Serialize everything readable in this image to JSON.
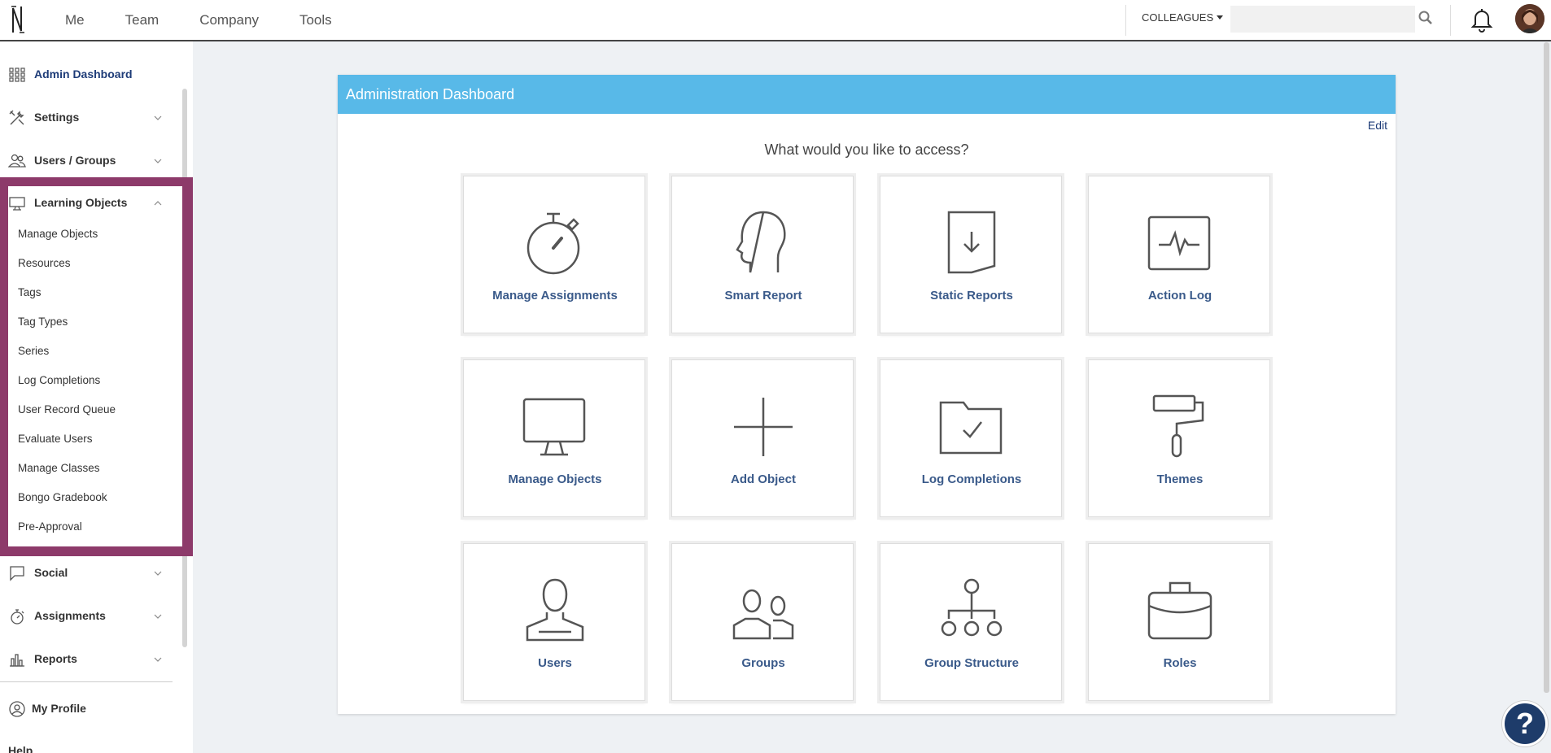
{
  "topbar": {
    "nav": [
      "Me",
      "Team",
      "Company",
      "Tools"
    ],
    "colleagues_label": "COLLEAGUES",
    "search_placeholder": ""
  },
  "sidebar": {
    "admin_dashboard": "Admin Dashboard",
    "settings": "Settings",
    "users_groups": "Users / Groups",
    "learning_objects": "Learning Objects",
    "sub_items": [
      "Manage Objects",
      "Resources",
      "Tags",
      "Tag Types",
      "Series",
      "Log Completions",
      "User Record Queue",
      "Evaluate Users",
      "Manage Classes",
      "Bongo Gradebook",
      "Pre-Approval"
    ],
    "social": "Social",
    "assignments": "Assignments",
    "reports": "Reports",
    "my_profile": "My Profile",
    "help": "Help"
  },
  "panel": {
    "title": "Administration Dashboard",
    "edit": "Edit",
    "question": "What would you like to access?",
    "tiles": [
      {
        "label": "Manage Assignments",
        "icon": "stopwatch-icon"
      },
      {
        "label": "Smart Report",
        "icon": "head-icon"
      },
      {
        "label": "Static Reports",
        "icon": "document-download-icon"
      },
      {
        "label": "Action Log",
        "icon": "activity-monitor-icon"
      },
      {
        "label": "Manage Objects",
        "icon": "monitor-icon"
      },
      {
        "label": "Add Object",
        "icon": "plus-icon"
      },
      {
        "label": "Log Completions",
        "icon": "folder-check-icon"
      },
      {
        "label": "Themes",
        "icon": "paint-roller-icon"
      },
      {
        "label": "Users",
        "icon": "user-icon"
      },
      {
        "label": "Groups",
        "icon": "group-icon"
      },
      {
        "label": "Group Structure",
        "icon": "hierarchy-icon"
      },
      {
        "label": "Roles",
        "icon": "briefcase-icon"
      }
    ]
  },
  "help_button": "?",
  "colors": {
    "header_blue": "#58b9e8",
    "highlight_purple": "#8d3a6a",
    "tile_label": "#3a5a8a",
    "nav_dark_blue": "#1e3c78"
  }
}
